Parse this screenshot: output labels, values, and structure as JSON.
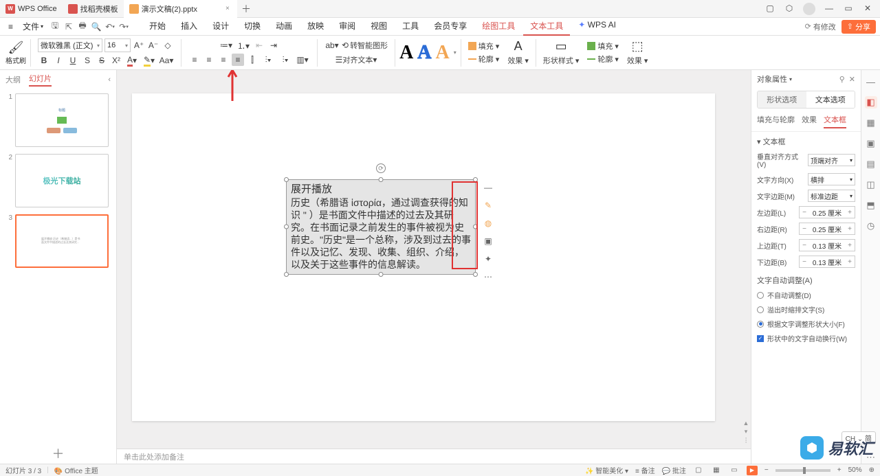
{
  "titlebar": {
    "app_name": "WPS Office",
    "tabs": [
      {
        "label": "找稻壳模板"
      },
      {
        "label": "演示文稿(2).pptx"
      }
    ]
  },
  "menubar": {
    "file": "文件",
    "tabs": [
      "开始",
      "插入",
      "设计",
      "切换",
      "动画",
      "放映",
      "审阅",
      "视图",
      "工具",
      "会员专享"
    ],
    "context_tabs": [
      "绘图工具",
      "文本工具"
    ],
    "ai": "WPS AI",
    "changes": "有修改",
    "share": "分享"
  },
  "ribbon": {
    "format_brush": "格式刷",
    "font_name": "微软雅黑 (正文)",
    "font_size": "16",
    "smart_convert": "转智能图形",
    "align_text": "对齐文本",
    "fill": "填充",
    "outline": "轮廓",
    "effect": "效果",
    "shape_style": "形状样式",
    "fill2": "填充",
    "outline2": "轮廓",
    "effect2": "效果"
  },
  "thumbs": {
    "tab_outline": "大纲",
    "tab_slides": "幻灯片",
    "slide2_text": "极光下载站"
  },
  "canvas": {
    "title": "展开播放",
    "body": "历史（希腊语 ἱστορία，通过调查获得的知识 \" ）是书面文件中描述的过去及其研究。在书面记录之前发生的事件被视为史前史。\"历史\"是一个总称，涉及到过去的事件以及记忆、发现、收集、组织、介绍，以及关于这些事件的信息解读。",
    "notes_placeholder": "单击此处添加备注"
  },
  "props": {
    "title": "对象属性",
    "seg_shape": "形状选项",
    "seg_text": "文本选项",
    "tab_fill": "填充与轮廓",
    "tab_effect": "效果",
    "tab_textbox": "文本框",
    "section_textbox": "文本框",
    "valign_label": "垂直对齐方式(V)",
    "valign_value": "顶端对齐",
    "direction_label": "文字方向(X)",
    "direction_value": "横排",
    "margin_label": "文字边距(M)",
    "margin_value": "标准边距",
    "left_label": "左边距(L)",
    "right_label": "右边距(R)",
    "top_label": "上边距(T)",
    "bottom_label": "下边距(B)",
    "left_val": "0.25 厘米",
    "right_val": "0.25 厘米",
    "top_val": "0.13 厘米",
    "bottom_val": "0.13 厘米",
    "autofit_section": "文字自动调整(A)",
    "autofit_none": "不自动调整(D)",
    "autofit_shrink": "溢出时缩排文字(S)",
    "autofit_resize": "根据文字调整形状大小(F)",
    "wrap": "形状中的文字自动换行(W)"
  },
  "status": {
    "slide_info": "幻灯片 3 / 3",
    "theme": "Office 主题",
    "smart": "智能美化",
    "notes": "备注",
    "comments": "批注",
    "zoom": "50%"
  },
  "ime": "CH ⌄ 简",
  "watermark": "易软汇"
}
